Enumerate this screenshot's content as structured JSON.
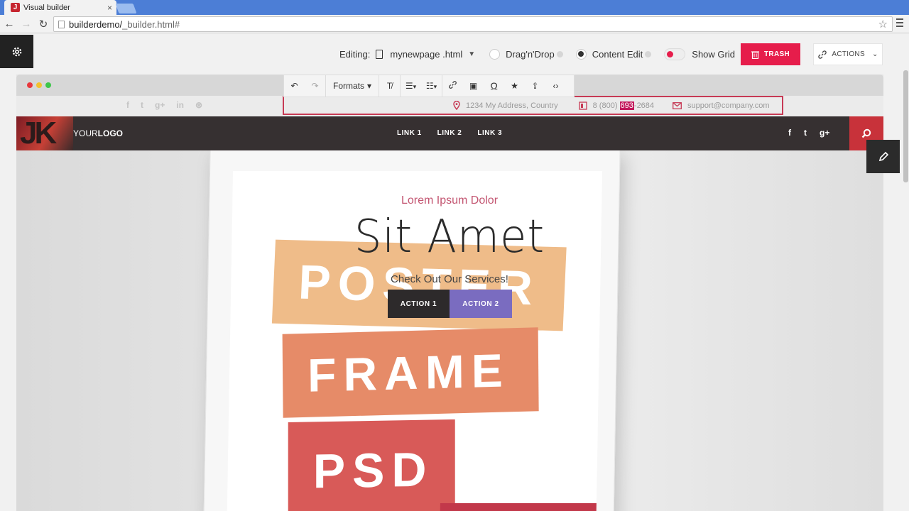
{
  "browser": {
    "tab_title": "Visual builder",
    "tab_close": "×",
    "favicon_letter": "J",
    "url_host": "builderdemo/",
    "url_path": "_builder.html#",
    "back_icon": "←",
    "forward_icon": "→",
    "reload_icon": "↻",
    "star_icon": "☆"
  },
  "builder": {
    "editing_label": "Editing:",
    "filename": "mynewpage .html",
    "mode_dragdrop": "Drag'n'Drop",
    "mode_content_edit": "Content Edit",
    "show_grid": "Show Grid",
    "trash_label": "TRASH",
    "actions_label": "ACTIONS",
    "accent_color": "#e61d4b"
  },
  "editor_toolbar": {
    "formats_label": "Formats",
    "undo_icon": "↶",
    "redo_icon": "↷",
    "clear_format_icon": "T̸",
    "bullet_list_icon": "☰",
    "numbered_list_icon": "☷",
    "link_icon": "🔗",
    "image_icon": "▣",
    "omega_icon": "Ω",
    "star_icon": "★",
    "share_icon": "⇪",
    "code_icon": "‹›",
    "caret": "▾"
  },
  "topbar": {
    "social_icons": [
      "f",
      "t",
      "g+",
      "in",
      "⊛"
    ],
    "address": "1234 My Address, Country",
    "phone_prefix": "8 (800) ",
    "phone_highlight": "693",
    "phone_suffix": "-2684",
    "email": "support@company.com"
  },
  "site_nav": {
    "logo_mark": "JK",
    "logo_text_light": "YOUR",
    "logo_text_bold": "LOGO",
    "links": [
      "LINK 1",
      "LINK 2",
      "LINK 3"
    ],
    "social": [
      "f",
      "t",
      "g+"
    ]
  },
  "hero": {
    "subtitle": "Lorem Ipsum Dolor",
    "title": "Sit Amet",
    "caption": "Check Out Our Services!",
    "action1": "ACTION 1",
    "action2": "ACTION 2",
    "poster_words": [
      "POSTER",
      "FRAME",
      "PSD"
    ]
  }
}
